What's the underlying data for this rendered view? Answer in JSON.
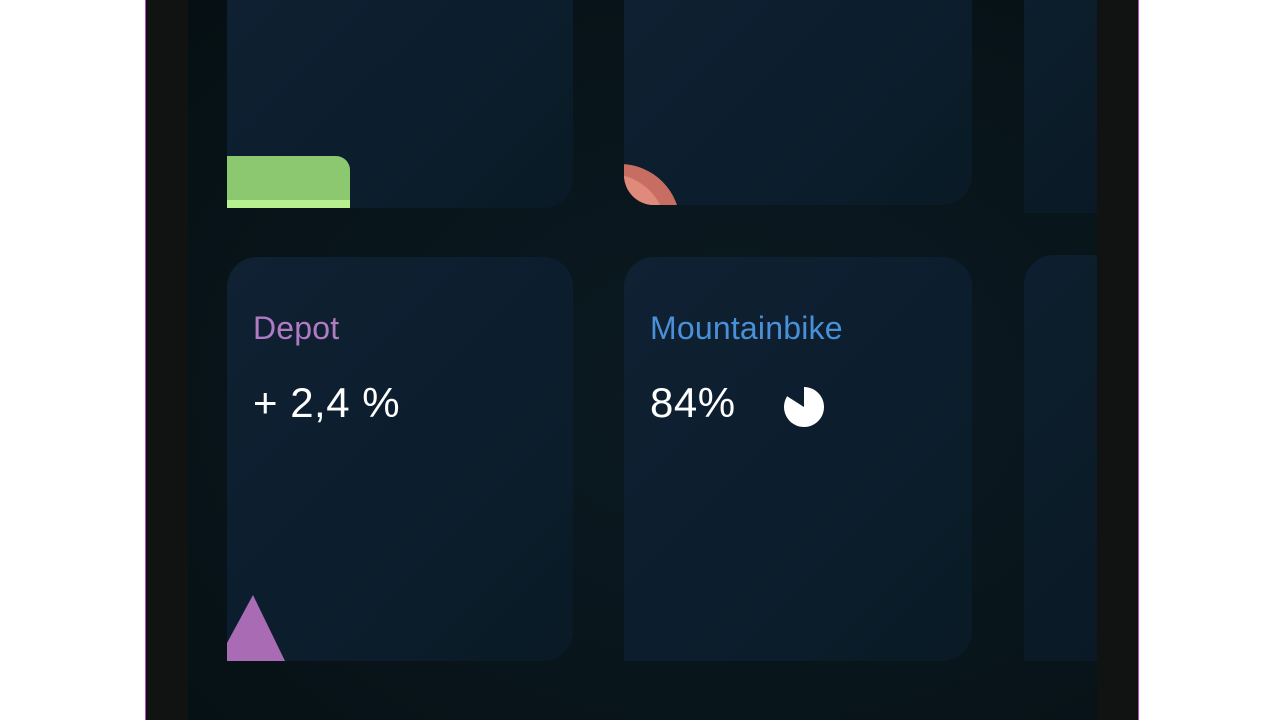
{
  "tiles": {
    "depot": {
      "label": "Depot",
      "value": "+ 2,4 %",
      "label_color": "#b07ac4",
      "icon": "triangle-icon",
      "icon_color": "#a86bb4"
    },
    "mountainbike": {
      "label": "Mountainbike",
      "value": "84%",
      "label_color": "#4a90d8",
      "icon": "pie-chart-icon",
      "progress_fraction": 0.84
    },
    "top_left": {
      "icon": "green-bar-icon",
      "color": "#8cc870"
    },
    "top_middle": {
      "icon": "red-arc-icon",
      "color": "#e08a7b"
    }
  },
  "colors": {
    "background": "#08151b",
    "tile": "#0f2132",
    "device_frame": "#111313",
    "frame_border": "#b04cc4"
  }
}
